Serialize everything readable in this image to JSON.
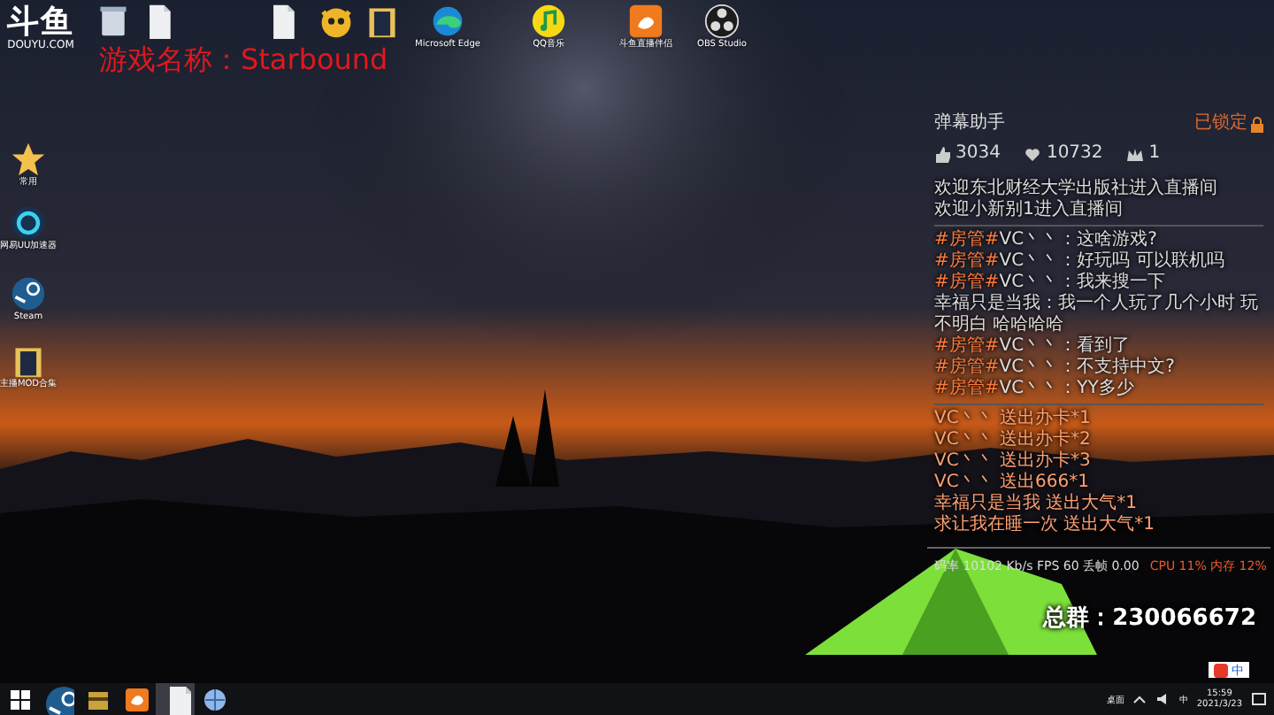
{
  "overlay": {
    "logo_text": "斗鱼",
    "logo_sub": "DOUYU.COM",
    "game_title": "游戏名称：Starbound"
  },
  "desktop_icons": [
    {
      "kind": "recycle"
    },
    {
      "kind": "file"
    },
    {
      "kind": "file"
    },
    {
      "kind": "cat"
    },
    {
      "kind": "folder"
    },
    {
      "kind": "edge",
      "label": "Microsoft Edge"
    },
    {
      "kind": "music",
      "label": "QQ音乐"
    },
    {
      "kind": "companion",
      "label": "斗鱼直播伴侣"
    },
    {
      "kind": "obs",
      "label": "OBS Studio"
    },
    {
      "kind": "star",
      "label": "常用"
    },
    {
      "kind": "uu",
      "label": "网易UU加速器"
    },
    {
      "kind": "steam",
      "label": "Steam"
    },
    {
      "kind": "folder",
      "label": "主播MOD合集"
    }
  ],
  "chat": {
    "title": "弹幕助手",
    "lock_label": "已锁定",
    "stats": [
      {
        "kind": "like",
        "value": "3034"
      },
      {
        "kind": "gift",
        "value": "10732"
      },
      {
        "kind": "crown",
        "value": "1"
      }
    ],
    "messages": [
      {
        "kind": "welcome",
        "text": "欢迎东北财经大学出版社进入直播间"
      },
      {
        "kind": "welcome",
        "text": "欢迎小新别1进入直播间"
      },
      {
        "kind": "chat",
        "badge": "#房管#",
        "user": "VC丶丶",
        "text": "：这啥游戏?"
      },
      {
        "kind": "chat",
        "badge": "#房管#",
        "user": "VC丶丶",
        "text": "：好玩吗 可以联机吗"
      },
      {
        "kind": "chat",
        "badge": "#房管#",
        "user": "VC丶丶",
        "text": "：我来搜一下"
      },
      {
        "kind": "chat",
        "user": "幸福只是当我",
        "text": "：我一个人玩了几个小时 玩不明白 哈哈哈哈"
      },
      {
        "kind": "chat",
        "badge": "#房管#",
        "user": "VC丶丶",
        "text": "：看到了"
      },
      {
        "kind": "chat",
        "badge": "#房管#",
        "user": "VC丶丶",
        "text": "：不支持中文?"
      },
      {
        "kind": "chat",
        "badge": "#房管#",
        "user": "VC丶丶",
        "text": "：YY多少"
      },
      {
        "kind": "gift",
        "text": "VC丶丶 送出办卡*1"
      },
      {
        "kind": "gift",
        "text": "VC丶丶 送出办卡*2"
      },
      {
        "kind": "gift",
        "text": "VC丶丶 送出办卡*3"
      },
      {
        "kind": "gift",
        "text": "VC丶丶 送出666*1"
      },
      {
        "kind": "gift",
        "text": "幸福只是当我 送出大气*1"
      },
      {
        "kind": "gift",
        "text": "求让我在睡一次 送出大气*1"
      }
    ],
    "footer_left": "码率 10102 Kb/s FPS 60 丢帧 0.00",
    "footer_right": "CPU 11% 内存 12%"
  },
  "group_number": "总群：230066672",
  "ime_label": "中",
  "taskbar": {
    "apps": [
      {
        "kind": "windows",
        "selected": false
      },
      {
        "kind": "steam",
        "selected": false
      },
      {
        "kind": "app",
        "selected": false
      },
      {
        "kind": "douyu",
        "selected": false
      },
      {
        "kind": "file",
        "selected": true
      },
      {
        "kind": "network",
        "selected": false
      }
    ],
    "desktop_label": "桌面",
    "input_label": "中",
    "time": "15:59",
    "date": "2021/3/23"
  }
}
